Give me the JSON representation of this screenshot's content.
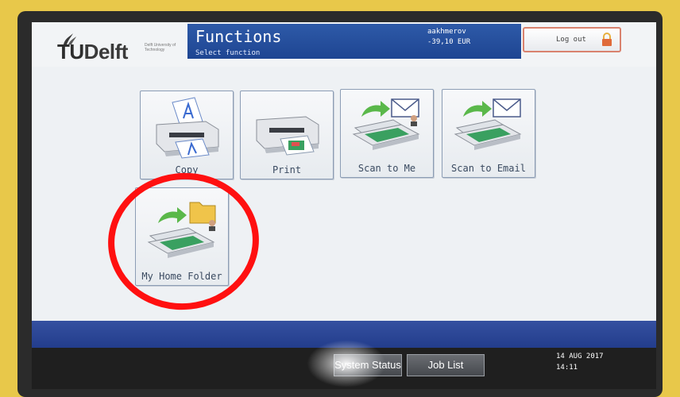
{
  "header": {
    "title": "Functions",
    "subtitle": "Select function",
    "user_name": "aakhmerov",
    "balance": "-39,10 EUR",
    "logout_label": "Log out"
  },
  "logo": {
    "brand_tu": "TU",
    "brand_delft": "Delft",
    "subtext": "Delft University of Technology"
  },
  "functions": [
    {
      "label": "Copy",
      "icon": "copier-icon"
    },
    {
      "label": "Print",
      "icon": "printer-icon"
    },
    {
      "label": "Scan to Me",
      "icon": "scan-to-me-icon"
    },
    {
      "label": "Scan to Email",
      "icon": "scan-to-email-icon"
    },
    {
      "label": "My Home Folder",
      "icon": "scan-to-folder-icon"
    }
  ],
  "footer": {
    "system_status_label": "System Status",
    "job_list_label": "Job List",
    "date": "14 AUG  2017",
    "time": "14:11"
  },
  "colors": {
    "title_bar": "#1e4592",
    "highlight": "#ff1010",
    "tile_border": "#8c9db5",
    "footer_band": "#233d8c"
  }
}
